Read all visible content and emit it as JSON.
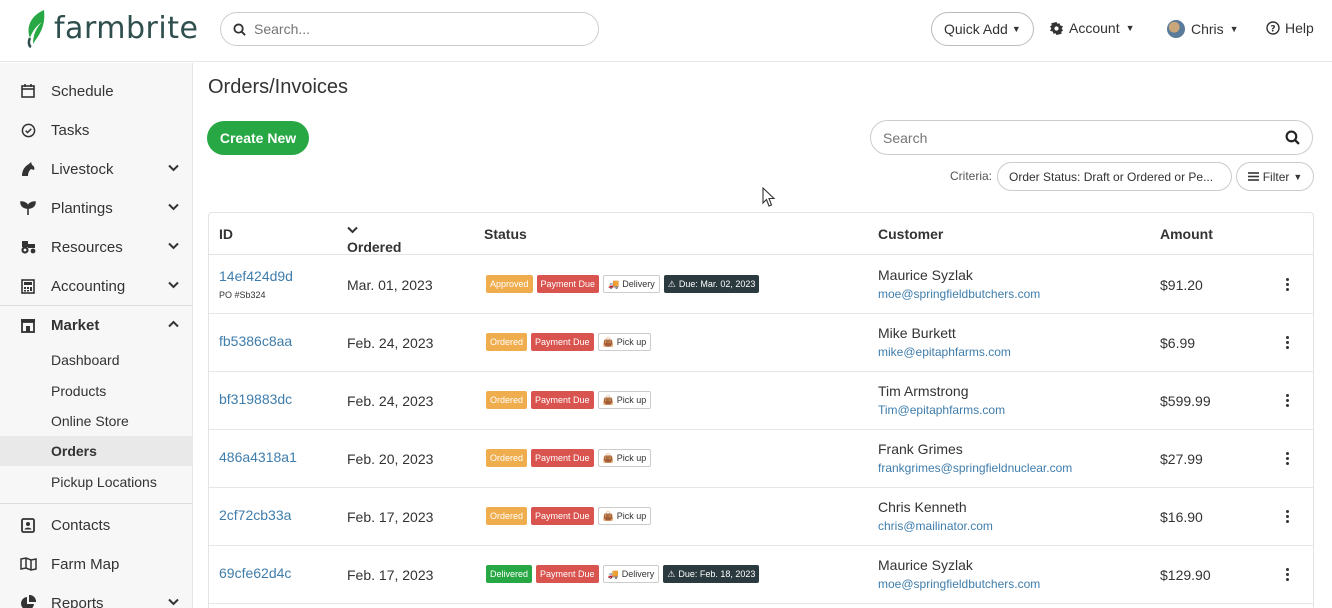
{
  "header": {
    "brand": "farmbrite",
    "search_placeholder": "Search...",
    "quick_add_label": "Quick Add",
    "account_label": "Account",
    "user_label": "Chris",
    "help_label": "Help"
  },
  "sidebar": {
    "items": [
      {
        "label": "Schedule"
      },
      {
        "label": "Tasks"
      },
      {
        "label": "Livestock"
      },
      {
        "label": "Plantings"
      },
      {
        "label": "Resources"
      },
      {
        "label": "Accounting"
      },
      {
        "label": "Market"
      },
      {
        "label": "Contacts"
      },
      {
        "label": "Farm Map"
      },
      {
        "label": "Reports"
      }
    ],
    "market_sub": [
      {
        "label": "Dashboard"
      },
      {
        "label": "Products"
      },
      {
        "label": "Online Store"
      },
      {
        "label": "Orders"
      },
      {
        "label": "Pickup Locations"
      }
    ]
  },
  "main": {
    "title": "Orders/Invoices",
    "create_label": "Create New",
    "search_placeholder": "Search",
    "criteria_label": "Criteria:",
    "criteria_value": "Order Status: Draft or Ordered or Pe...",
    "filter_label": "Filter"
  },
  "table": {
    "columns": [
      "ID",
      "Ordered",
      "Status",
      "Customer",
      "Amount"
    ],
    "rows": [
      {
        "id": "14ef424d9d",
        "po": "PO #Sb324",
        "date": "Mar. 01, 2023",
        "order_status": "Approved",
        "payment": "Payment Due",
        "method": "Delivery",
        "due": "Due: Mar. 02, 2023",
        "name": "Maurice Syzlak",
        "email": "moe@springfieldbutchers.com",
        "amount": "$91.20"
      },
      {
        "id": "fb5386c8aa",
        "po": "",
        "date": "Feb. 24, 2023",
        "order_status": "Ordered",
        "payment": "Payment Due",
        "method": "Pick up",
        "due": "",
        "name": "Mike Burkett",
        "email": "mike@epitaphfarms.com",
        "amount": "$6.99"
      },
      {
        "id": "bf319883dc",
        "po": "",
        "date": "Feb. 24, 2023",
        "order_status": "Ordered",
        "payment": "Payment Due",
        "method": "Pick up",
        "due": "",
        "name": "Tim Armstrong",
        "email": "Tim@epitaphfarms.com",
        "amount": "$599.99"
      },
      {
        "id": "486a4318a1",
        "po": "",
        "date": "Feb. 20, 2023",
        "order_status": "Ordered",
        "payment": "Payment Due",
        "method": "Pick up",
        "due": "",
        "name": "Frank Grimes",
        "email": "frankgrimes@springfieldnuclear.com",
        "amount": "$27.99"
      },
      {
        "id": "2cf72cb33a",
        "po": "",
        "date": "Feb. 17, 2023",
        "order_status": "Ordered",
        "payment": "Payment Due",
        "method": "Pick up",
        "due": "",
        "name": "Chris Kenneth",
        "email": "chris@mailinator.com",
        "amount": "$16.90"
      },
      {
        "id": "69cfe62d4c",
        "po": "",
        "date": "Feb. 17, 2023",
        "order_status": "Delivered",
        "payment": "Payment Due",
        "method": "Delivery",
        "due": "Due: Feb. 18, 2023",
        "name": "Maurice Syzlak",
        "email": "moe@springfieldbutchers.com",
        "amount": "$129.90"
      }
    ]
  },
  "colors": {
    "brand_green": "#27a844",
    "link_blue": "#3f7dac",
    "approved": "#f0ad4e",
    "payment_due": "#d9534f",
    "due_dark": "#2b3a3f"
  }
}
